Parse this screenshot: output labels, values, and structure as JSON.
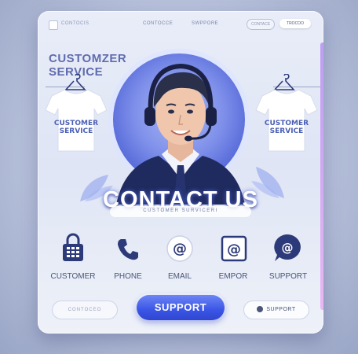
{
  "nav": {
    "brand": "CONTOCIS",
    "links": [
      "CONTOCCE",
      "SWPPORE"
    ],
    "pill_outline": "CONTACE",
    "pill_solid": "TROCOO"
  },
  "hero": {
    "title_line1": "CUSTOMZER",
    "title_line2": "SERVICE",
    "shirt_left_line1": "CUSTOMER",
    "shirt_left_line2": "SERVICE",
    "shirt_right_line1": "CUSTOMER",
    "shirt_right_line2": "SERVICE",
    "contact_title": "CONTACT US",
    "subtitle": "CUSTOMER SURVICERI"
  },
  "icons": [
    {
      "label": "CUSTOMER",
      "icon": "lock-keypad-icon"
    },
    {
      "label": "PHONE",
      "icon": "phone-icon"
    },
    {
      "label": "EMAIL",
      "icon": "at-sign-icon"
    },
    {
      "label": "EMPOR",
      "icon": "at-sign-square-icon"
    },
    {
      "label": "SUPPORT",
      "icon": "chat-bubble-icon"
    }
  ],
  "buttons": {
    "left": "CONTOCEO",
    "main": "SUPPORT",
    "right": "SUPPORT"
  },
  "colors": {
    "accent": "#3a55e6",
    "navy": "#2c3a7a",
    "label": "#4a5578"
  }
}
